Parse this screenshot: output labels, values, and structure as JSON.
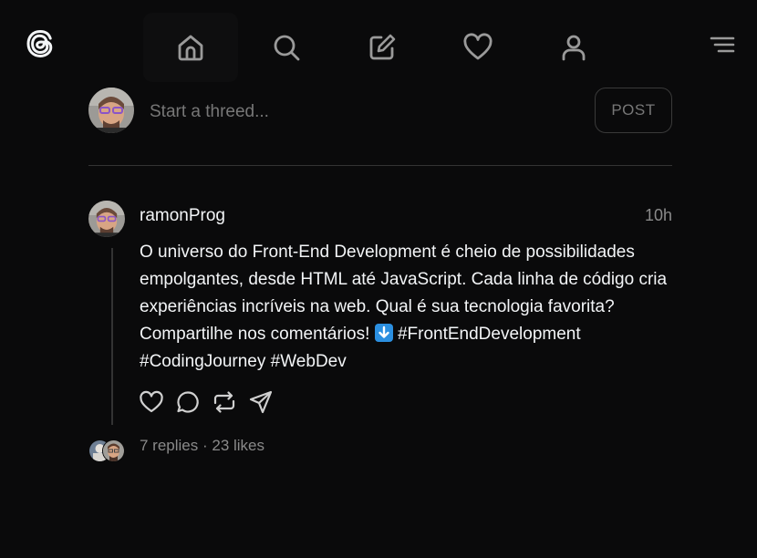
{
  "nav": {
    "items": [
      {
        "name": "home",
        "active": true
      },
      {
        "name": "search",
        "active": false
      },
      {
        "name": "compose",
        "active": false
      },
      {
        "name": "activity",
        "active": false
      },
      {
        "name": "profile",
        "active": false
      }
    ]
  },
  "composer": {
    "placeholder": "Start a threed...",
    "post_label": "POST"
  },
  "thread": {
    "username": "ramonProg",
    "time": "10h",
    "text_before_emoji": "O universo do Front-End Development é cheio de possibilidades empolgantes, desde HTML até JavaScript. Cada linha de código cria experiências incríveis na web. Qual é sua tecnologia favorita? Compartilhe nos comentários! ",
    "text_after_emoji": " #FrontEndDevelopment #CodingJourney #WebDev",
    "stats": "7 replies · 23 likes"
  },
  "colors": {
    "background": "#0a0a0b",
    "text": "#f3f5f7",
    "muted": "#8a8a8a",
    "divider": "#333333"
  }
}
